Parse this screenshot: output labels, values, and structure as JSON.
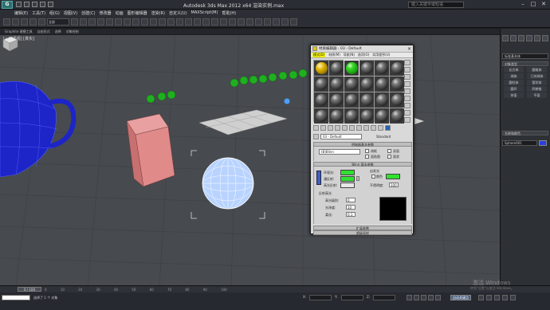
{
  "window": {
    "title": "Autodesk 3ds Max 2012 x64      渲染实例.max",
    "search_placeholder": "键入关键字或短语",
    "minimize": "–",
    "maximize": "□",
    "close": "✕"
  },
  "menubar": [
    "编辑(E)",
    "工具(T)",
    "组(G)",
    "视图(V)",
    "创建(C)",
    "修改器",
    "动画",
    "图形编辑器",
    "渲染(R)",
    "自定义(U)",
    "MAXScript(M)",
    "帮助(H)"
  ],
  "toolbar": {
    "selection_filter": "全部"
  },
  "ribbon_tabs": [
    "Graphite 建模工具",
    "自由形式",
    "选择",
    "对象绘制"
  ],
  "viewport": {
    "label": "[+] [透视] [真实]"
  },
  "material_editor": {
    "title": "材质编辑器 - 03 - Default",
    "menu": [
      "模式(D)",
      "材质(M)",
      "导航(N)",
      "选项(O)",
      "实用程序(U)"
    ],
    "material_name": "03 - Default",
    "material_type": "Standard",
    "rollout_shader_basic": "明暗器基本参数",
    "shader": "(B)Blinn",
    "checkboxes": [
      "线框",
      "双面",
      "面贴图",
      "面状"
    ],
    "rollout_blinn_basic": "Blinn 基本参数",
    "ambient_label": "环境光:",
    "diffuse_label": "漫反射:",
    "specular_label": "高光反射:",
    "self_illum_label": "自发光",
    "color_label": "颜色",
    "color_value": "0",
    "opacity_label": "不透明度:",
    "opacity_value": "100",
    "specular_highlights": "反射高光",
    "specular_level_label": "高光级别:",
    "specular_level_value": "0",
    "glossiness_label": "光泽度:",
    "glossiness_value": "10",
    "soften_label": "柔化:",
    "soften_value": "0.1",
    "rollout_extended": "扩展参数",
    "rollout_supersampling": "超级采样",
    "green_color": "#30e030",
    "yellow_highlight": "#f2f200"
  },
  "command_panel": {
    "dropdown": "标准基本体",
    "rollout_object_type": "对象类型",
    "auto_grid": "自动栅格",
    "object_types": [
      "长方体",
      "圆锥体",
      "球体",
      "几何球体",
      "圆柱体",
      "管状体",
      "圆环",
      "四棱锥",
      "茶壶",
      "平面"
    ],
    "rollout_name_color": "名称和颜色",
    "object_name": "Sphere001",
    "object_color": "#2a3fe0"
  },
  "timeline": {
    "frame": "0 / 100",
    "ticks": "0 10 20 30 40 50 60 70 80 90 100"
  },
  "status": {
    "text": "选择了 1 个 对象",
    "x_label": "X:",
    "y_label": "Y:",
    "z_label": "Z:",
    "autokey": "自动关键点"
  },
  "watermark": {
    "line1": "激活 Windows",
    "line2": "转到\"设置\"以激活 Windows。"
  }
}
